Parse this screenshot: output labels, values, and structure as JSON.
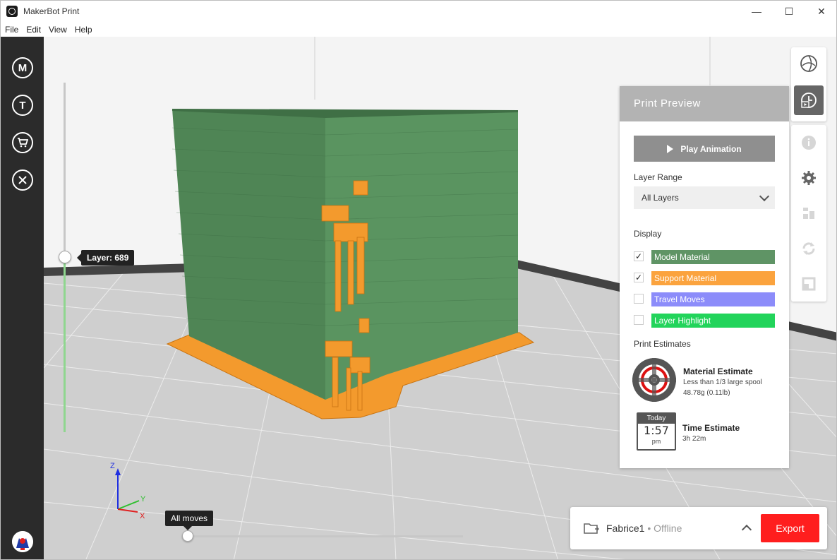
{
  "window": {
    "title": "MakerBot Print",
    "minimize_glyph": "—",
    "maximize_glyph": "☐",
    "close_glyph": "✕"
  },
  "menu": [
    "File",
    "Edit",
    "View",
    "Help"
  ],
  "sidebar": {
    "items": [
      {
        "icon": "makerbot-logo-icon",
        "glyph": "M"
      },
      {
        "icon": "thingiverse-icon",
        "glyph": "T"
      },
      {
        "icon": "cart-icon",
        "glyph": "🛒"
      },
      {
        "icon": "tools-icon",
        "glyph": "✕"
      }
    ]
  },
  "viewport": {
    "layer_label": "Layer: 689",
    "layer_position": 0.5,
    "moves_label": "All moves",
    "moves_position": 0.0,
    "axis": {
      "z": "Z",
      "y": "Y",
      "x": "X"
    }
  },
  "tools": {
    "top": [
      "view-cube-icon",
      "print-preview-icon"
    ],
    "bottom": [
      "info-icon",
      "settings-gear-icon",
      "arrange-icon",
      "rotate-icon",
      "scale-icon"
    ]
  },
  "print_preview": {
    "title": "Print Preview",
    "play_label": "Play Animation",
    "layer_range_label": "Layer Range",
    "layer_range_value": "All Layers",
    "display_label": "Display",
    "display_items": [
      {
        "label": "Model Material",
        "checked": true,
        "checkmark": "✓",
        "color": "#5f9465"
      },
      {
        "label": "Support Material",
        "checked": true,
        "checkmark": "✓",
        "color": "#fba33e"
      },
      {
        "label": "Travel Moves",
        "checked": false,
        "checkmark": "",
        "color": "#8c8cfa"
      },
      {
        "label": "Layer Highlight",
        "checked": false,
        "checkmark": "",
        "color": "#22d45b"
      }
    ],
    "estimates_label": "Print Estimates",
    "material": {
      "title": "Material Estimate",
      "line1": "Less than 1/3 large spool",
      "line2": "48.78g (0.11lb)"
    },
    "time": {
      "title": "Time Estimate",
      "value": "3h 22m",
      "clock_header": "Today",
      "clock_time": "1:57",
      "clock_ampm": "pm"
    }
  },
  "export_bar": {
    "printer": "Fabrice1",
    "status": " • Offline",
    "export_label": "Export"
  },
  "colors": {
    "model": "#5f9465",
    "support": "#fba33e",
    "export": "#ff1e1e",
    "sidebar": "#2b2b2b"
  }
}
